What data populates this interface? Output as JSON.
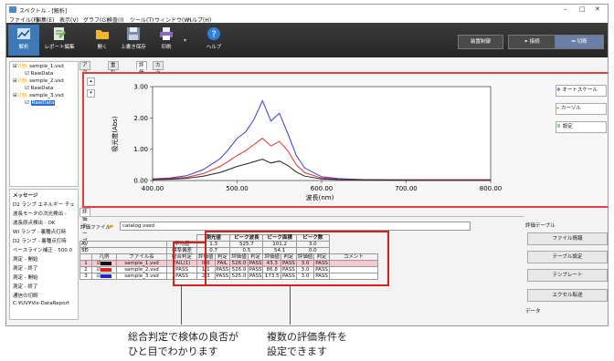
{
  "window": {
    "title": "スペクトル - [解析]"
  },
  "menu": [
    "ファイル(F)",
    "編集(E)",
    "表示(V)",
    "グラフ(G)",
    "検査(I)",
    "ツール(T)",
    "ウィンドウ(W)",
    "ヘルプ(H)"
  ],
  "toolbar": {
    "buttons": [
      {
        "label": "解析",
        "icon": "analysis-icon"
      },
      {
        "label": "レポート編集",
        "icon": "report-edit-icon"
      },
      {
        "label": "開く",
        "icon": "folder-icon"
      },
      {
        "label": "上書き保存",
        "icon": "save-icon"
      },
      {
        "label": "印刷",
        "icon": "print-icon"
      },
      {
        "label": "ヘルプ",
        "icon": "help-icon"
      }
    ],
    "device_control": "装置制御",
    "connect": "接続",
    "disconnect": "切断"
  },
  "tree": {
    "items": [
      {
        "label": "sample_1.vsd"
      },
      {
        "label": "RawData"
      },
      {
        "label": "sample_2.vsd"
      },
      {
        "label": "RawData"
      },
      {
        "label": "sample_3.vsd"
      },
      {
        "label": "RawData"
      }
    ]
  },
  "messages": {
    "header": "メッセージ",
    "lines": [
      "D2 ランプ エネルギー チェ",
      "波長モータの次光検出 -",
      "波長原点検出 - OK",
      "WI ランプ - 裏種点灯時",
      "D2 ランプ - 裏種点灯時",
      "ベースライン補正 - 500.0",
      "測定 - 開始",
      "測定 - 終了",
      "測定 - 開始",
      "測定 - 終了",
      "通信の切断",
      "C:¥UV¥Vis-DataReport"
    ]
  },
  "tabs": [
    "アクティブ",
    "重ね描き",
    "評価",
    "カラー"
  ],
  "graph_side": {
    "autoscale": "オートスケール",
    "cursor": "カーソル",
    "settings": "設定"
  },
  "chart_data": {
    "type": "line",
    "xlabel": "波長(nm)",
    "ylabel": "吸光度(Abs)",
    "xlim": [
      400,
      800
    ],
    "ylim": [
      0,
      3
    ],
    "xticks": [
      "400.00",
      "500.00",
      "600.00",
      "700.00",
      "800.00"
    ],
    "yticks": [
      "3.00",
      "2.00",
      "1.00",
      "0.00"
    ],
    "series": [
      {
        "color": "#3b3bd8",
        "x": [
          400,
          420,
          440,
          460,
          480,
          490,
          500,
          510,
          520,
          530,
          540,
          550,
          560,
          570,
          580,
          600,
          620,
          650,
          700,
          750,
          800
        ],
        "y": [
          0.05,
          0.08,
          0.15,
          0.35,
          0.7,
          1.0,
          1.35,
          1.55,
          1.95,
          2.55,
          1.9,
          2.15,
          1.5,
          0.8,
          0.4,
          0.12,
          0.06,
          0.03,
          0.02,
          0.02,
          0.02
        ]
      },
      {
        "color": "#e03030",
        "x": [
          400,
          420,
          440,
          460,
          480,
          490,
          500,
          510,
          520,
          530,
          540,
          550,
          560,
          570,
          580,
          600,
          620,
          650,
          700,
          750,
          800
        ],
        "y": [
          0.04,
          0.06,
          0.1,
          0.22,
          0.45,
          0.62,
          0.8,
          0.95,
          1.15,
          1.35,
          1.1,
          1.25,
          0.95,
          0.5,
          0.25,
          0.08,
          0.04,
          0.02,
          0.02,
          0.02,
          0.02
        ]
      },
      {
        "color": "#222222",
        "x": [
          400,
          420,
          440,
          460,
          480,
          490,
          500,
          510,
          520,
          530,
          540,
          550,
          560,
          570,
          580,
          600,
          620,
          650,
          700,
          750,
          800
        ],
        "y": [
          0.03,
          0.04,
          0.07,
          0.14,
          0.26,
          0.35,
          0.45,
          0.52,
          0.6,
          0.68,
          0.56,
          0.62,
          0.48,
          0.27,
          0.14,
          0.05,
          0.03,
          0.02,
          0.01,
          0.01,
          0.01
        ]
      }
    ]
  },
  "eval": {
    "tab": "評価テーブル",
    "file_label": "評価ファイル",
    "file_value": "catalog.vsed",
    "groups": [
      "測光値",
      "ピーク波長",
      "ピーク面積",
      "ピーク数"
    ],
    "stat_rows": [
      {
        "label": "AV",
        "head": "平均値",
        "vals": [
          "1.3",
          "525.7",
          "101.2",
          "3.0"
        ]
      },
      {
        "label": "SD",
        "head": "標準偏差",
        "vals": [
          "0.7",
          "0.5",
          "54.1",
          "0.0"
        ]
      }
    ],
    "header": {
      "legend": "凡例",
      "file": "ファイル名",
      "overall": "総合判定",
      "eval": "評価値",
      "judge": "判定",
      "comment": "コメント"
    },
    "rows": [
      {
        "n": "1",
        "color": "#111111",
        "file": "sample_1.vsd",
        "overall": "FAIL(1)",
        "v": [
          "0.6",
          "FAIL",
          "526.0",
          "PASS",
          "43.3",
          "PASS",
          "3.0",
          "PASS"
        ],
        "hl": true
      },
      {
        "n": "2",
        "color": "#e02020",
        "file": "sample_2.vsd",
        "overall": "PASS",
        "v": [
          "1.1",
          "PASS",
          "526.0",
          "PASS",
          "86.8",
          "PASS",
          "3.0",
          "PASS"
        ],
        "hl": false
      },
      {
        "n": "3",
        "color": "#2020e0",
        "file": "sample_3.vsd",
        "overall": "PASS",
        "v": [
          "2.3",
          "PASS",
          "525.0",
          "PASS",
          "173.5",
          "PASS",
          "3.0",
          "PASS"
        ],
        "hl": false
      }
    ],
    "right_title": "評価テーブル",
    "right_buttons": [
      "ファイル情報",
      "テーブル設定",
      "テンプレート",
      "エクセル転送"
    ],
    "right_footer": "データ"
  },
  "captions": {
    "left": "総合判定で検体の良否が\nひと目でわかります",
    "right": "複数の評価条件を\n設定できます"
  }
}
